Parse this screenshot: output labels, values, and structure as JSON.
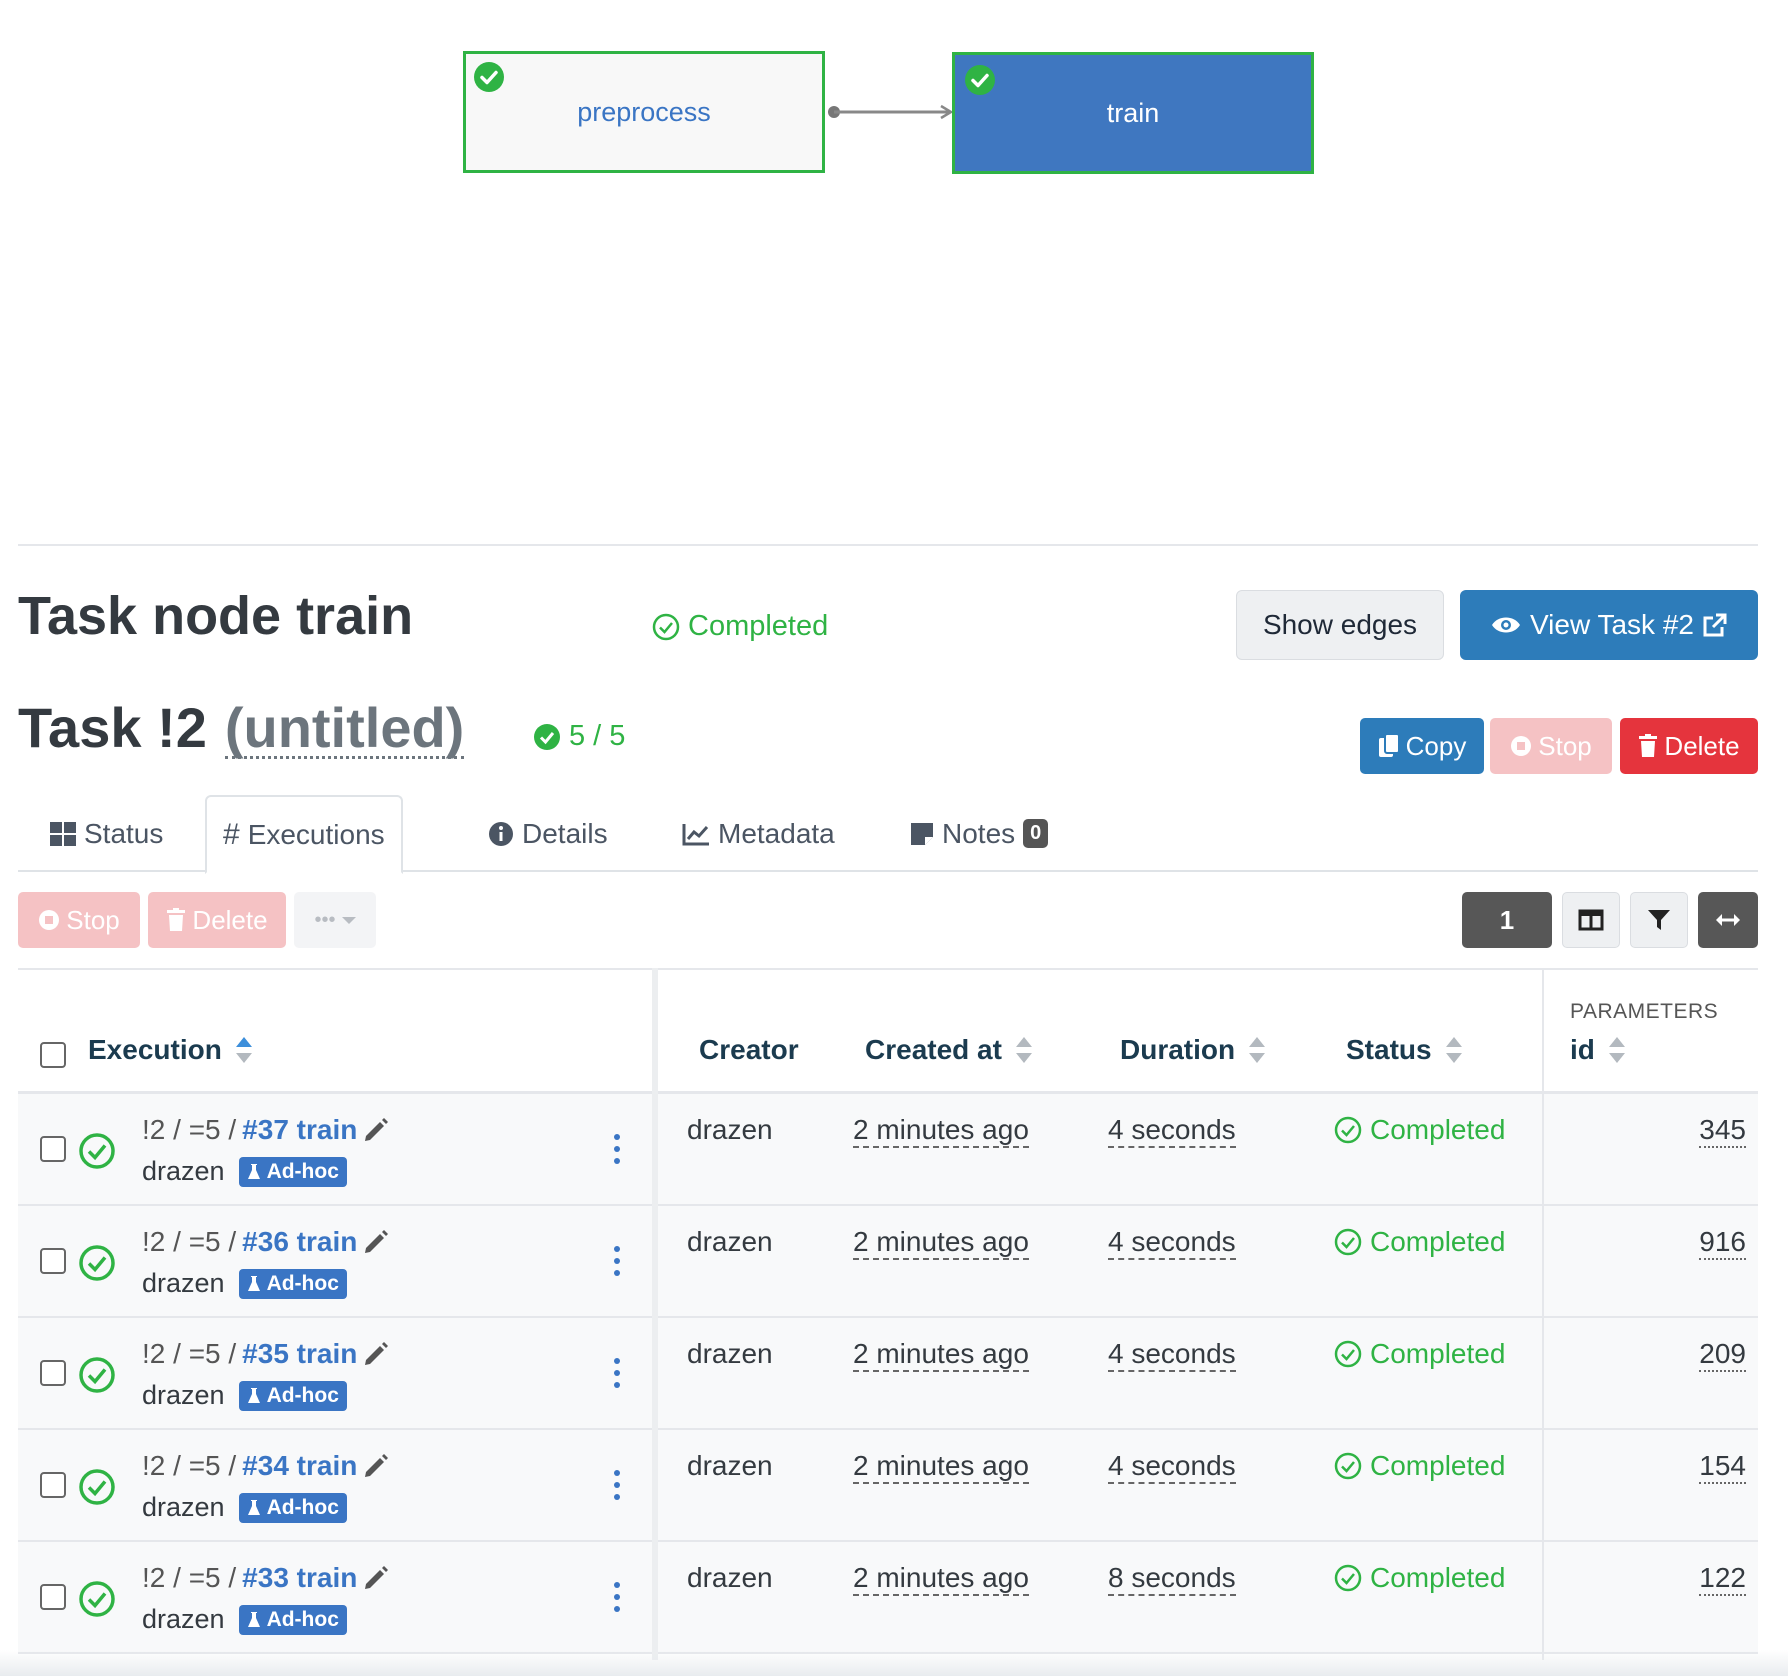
{
  "dag": {
    "nodes": [
      {
        "label": "preprocess",
        "status": "completed"
      },
      {
        "label": "train",
        "status": "completed",
        "selected": true
      }
    ]
  },
  "node_panel": {
    "title": "Task node train",
    "status": "Completed",
    "show_edges_label": "Show edges",
    "view_task_label": "View Task #2"
  },
  "task": {
    "title_prefix": "Task !2",
    "title_name": "(untitled)",
    "count": "5 / 5",
    "copy_label": "Copy",
    "stop_label": "Stop",
    "delete_label": "Delete"
  },
  "tabs": [
    {
      "label": "Status",
      "icon": "grid-icon"
    },
    {
      "label": "Executions",
      "icon": "hash-icon",
      "active": true
    },
    {
      "label": "Details",
      "icon": "info-icon"
    },
    {
      "label": "Metadata",
      "icon": "chart-line-icon"
    },
    {
      "label": "Notes",
      "icon": "note-icon",
      "badge": "0"
    }
  ],
  "toolbar": {
    "stop_label": "Stop",
    "delete_label": "Delete",
    "more_label": "•••",
    "page": "1"
  },
  "table": {
    "headers": {
      "execution": "Execution",
      "creator": "Creator",
      "created_at": "Created at",
      "duration": "Duration",
      "status": "Status",
      "group": "PARAMETERS",
      "id": "id"
    },
    "rows": [
      {
        "prefix": "!2 / =5 /",
        "number": "#37 train",
        "user": "drazen",
        "tag": "Ad-hoc",
        "creator": "drazen",
        "created": "2 minutes ago",
        "duration": "4 seconds",
        "status": "Completed",
        "id": "345"
      },
      {
        "prefix": "!2 / =5 /",
        "number": "#36 train",
        "user": "drazen",
        "tag": "Ad-hoc",
        "creator": "drazen",
        "created": "2 minutes ago",
        "duration": "4 seconds",
        "status": "Completed",
        "id": "916"
      },
      {
        "prefix": "!2 / =5 /",
        "number": "#35 train",
        "user": "drazen",
        "tag": "Ad-hoc",
        "creator": "drazen",
        "created": "2 minutes ago",
        "duration": "4 seconds",
        "status": "Completed",
        "id": "209"
      },
      {
        "prefix": "!2 / =5 /",
        "number": "#34 train",
        "user": "drazen",
        "tag": "Ad-hoc",
        "creator": "drazen",
        "created": "2 minutes ago",
        "duration": "4 seconds",
        "status": "Completed",
        "id": "154"
      },
      {
        "prefix": "!2 / =5 /",
        "number": "#33 train",
        "user": "drazen",
        "tag": "Ad-hoc",
        "creator": "drazen",
        "created": "2 minutes ago",
        "duration": "8 seconds",
        "status": "Completed",
        "id": "122"
      }
    ]
  },
  "colors": {
    "success": "#2fb344",
    "primary": "#2d7cba",
    "danger": "#e5343d",
    "link": "#3a75c4"
  }
}
